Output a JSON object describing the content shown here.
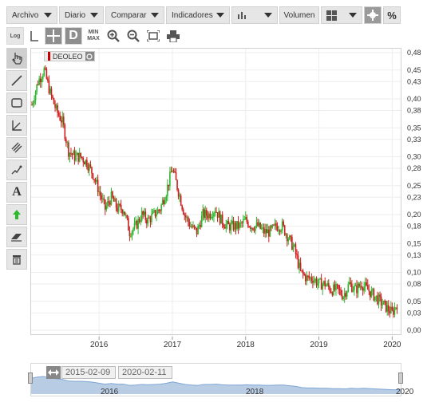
{
  "toolbar": {
    "archivo": "Archivo",
    "diario": "Diario",
    "comparar": "Comparar",
    "indicadores": "Indicadores",
    "volumen": "Volumen",
    "percent": "%"
  },
  "toolbar2": {
    "log": "Log",
    "d": "D",
    "min": "MIN",
    "max": "MAX"
  },
  "ticker": {
    "symbol": "DEOLEO"
  },
  "y_ticks": [
    "0,48",
    "0,45",
    "0,43",
    "0,40",
    "0,38",
    "0,35",
    "0,33",
    "0,30",
    "0,28",
    "0,25",
    "0,23",
    "0,20",
    "0,18",
    "0,15",
    "0,13",
    "0,10",
    "0,08",
    "0,05",
    "0,03",
    "0,00"
  ],
  "x_ticks": [
    "2016",
    "2017",
    "2018",
    "2019",
    "2020"
  ],
  "navigator": {
    "start_date": "2015-02-09",
    "end_date": "2020-02-11",
    "labels": [
      "2016",
      "2018",
      "2020"
    ]
  },
  "colors": {
    "up": "#2eb82e",
    "down": "#cc1f1f",
    "nav_fill": "#b8cce4",
    "nav_line": "#7ea6d6"
  },
  "chart_data": {
    "type": "line",
    "y_range": [
      0.0,
      0.48
    ],
    "x_range": [
      "2015-02",
      "2020-02"
    ],
    "series": [
      {
        "x": [
          "2015-02",
          "2015-03",
          "2015-04",
          "2015-05",
          "2015-06",
          "2015-07",
          "2015-08",
          "2015-09",
          "2015-10",
          "2015-11",
          "2015-12",
          "2016-01",
          "2016-02",
          "2016-03",
          "2016-04",
          "2016-05",
          "2016-06",
          "2016-07",
          "2016-08",
          "2016-09",
          "2016-10",
          "2016-11",
          "2016-12",
          "2017-01",
          "2017-02",
          "2017-03",
          "2017-04",
          "2017-05",
          "2017-06",
          "2017-07",
          "2017-08",
          "2017-09",
          "2017-10",
          "2017-11",
          "2017-12",
          "2018-01",
          "2018-02",
          "2018-03",
          "2018-04",
          "2018-05",
          "2018-06",
          "2018-07",
          "2018-08",
          "2018-09",
          "2018-10",
          "2018-11",
          "2018-12",
          "2019-01",
          "2019-02",
          "2019-03",
          "2019-04",
          "2019-05",
          "2019-06",
          "2019-07",
          "2019-08",
          "2019-09",
          "2019-10",
          "2019-11",
          "2019-12",
          "2020-01",
          "2020-02"
        ],
        "y": [
          0.39,
          0.43,
          0.45,
          0.41,
          0.38,
          0.36,
          0.31,
          0.3,
          0.3,
          0.29,
          0.27,
          0.24,
          0.21,
          0.23,
          0.21,
          0.21,
          0.17,
          0.18,
          0.2,
          0.19,
          0.2,
          0.21,
          0.24,
          0.28,
          0.24,
          0.2,
          0.18,
          0.17,
          0.2,
          0.2,
          0.21,
          0.19,
          0.18,
          0.18,
          0.18,
          0.19,
          0.18,
          0.18,
          0.17,
          0.17,
          0.18,
          0.18,
          0.16,
          0.14,
          0.1,
          0.09,
          0.09,
          0.08,
          0.08,
          0.07,
          0.07,
          0.06,
          0.08,
          0.07,
          0.08,
          0.07,
          0.06,
          0.05,
          0.04,
          0.03,
          0.05
        ]
      }
    ]
  }
}
